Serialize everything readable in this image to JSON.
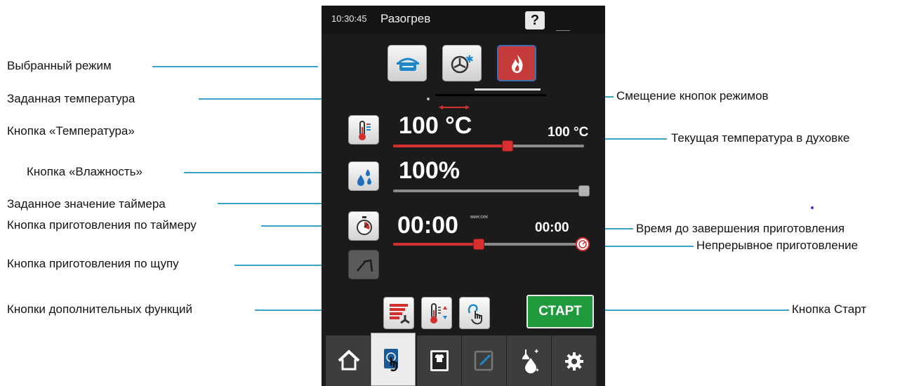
{
  "topbar": {
    "time": "10:30:45",
    "title": "Разогрев",
    "help_label": "?"
  },
  "callouts": {
    "selected_mode": "Выбранный режим",
    "set_temperature": "Заданная температура",
    "temperature_button": "Кнопка «Температура»",
    "humidity_button": "Кнопка «Влажность»",
    "set_timer": "Заданное значение таймера",
    "timer_cooking_button": "Кнопка приготовления по таймеру",
    "probe_cooking_button": "Кнопка приготовления по щупу",
    "extra_functions_buttons": "Кнопки дополнительных функций",
    "mode_buttons_shift": "Смещение кнопок режимов",
    "current_oven_temperature": "Текущая температура в духовке",
    "time_to_completion": "Время до завершения приготовления",
    "continuous_cooking": "Непрерывное приготовление",
    "start_button": "Кнопка Старт"
  },
  "modes": [
    {
      "name": "steam",
      "icon": "steam-pot-icon"
    },
    {
      "name": "combi",
      "icon": "fan-snowflake-icon"
    },
    {
      "name": "dry-heat",
      "icon": "flame-icon",
      "active": true
    }
  ],
  "temperature": {
    "set_value": "100 °C",
    "current_value": "100 °C",
    "slider_fraction": 0.6
  },
  "humidity": {
    "set_value": "100%",
    "slider_fraction": 1.0
  },
  "timer": {
    "set_value": "00:00",
    "unit": "мин:сек",
    "remaining": "00:00",
    "slider_fraction": 0.45
  },
  "start": {
    "label": "СТАРТ"
  },
  "colors": {
    "screen_bg": "#1b1b1b",
    "accent_red": "#d42f2f",
    "start_green": "#1f9a3c",
    "leader_blue": "#3aa3c9"
  },
  "nav": [
    {
      "icon": "home-icon"
    },
    {
      "icon": "manual-touch-icon",
      "active": true
    },
    {
      "icon": "chef-recipes-icon"
    },
    {
      "icon": "edit-program-icon"
    },
    {
      "icon": "cleaning-icon"
    },
    {
      "icon": "settings-gear-icon"
    }
  ]
}
